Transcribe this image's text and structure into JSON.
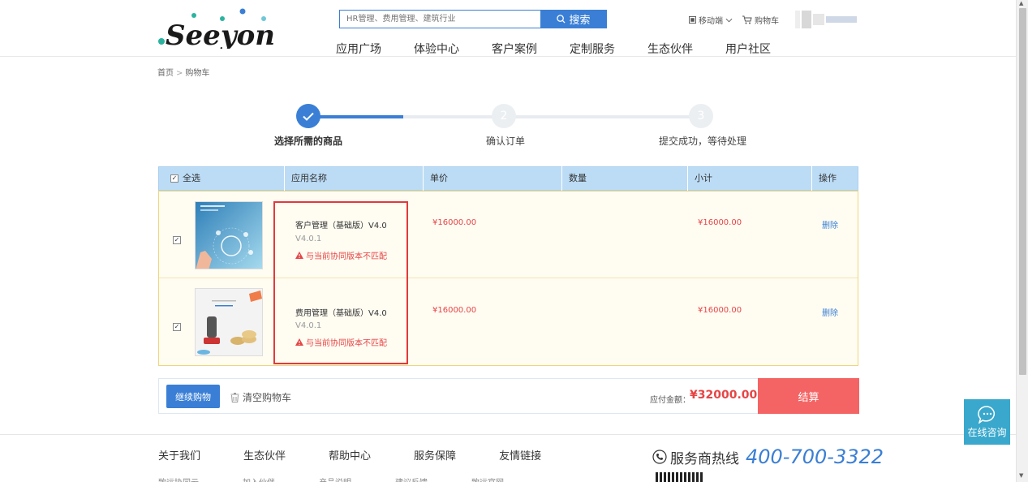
{
  "header": {
    "search_placeholder": "HR管理、费用管理、建筑行业",
    "search_button": "搜索",
    "nav": [
      "应用广场",
      "体验中心",
      "客户案例",
      "定制服务",
      "生态伙伴",
      "用户社区"
    ],
    "mobile_label": "移动端",
    "cart_label": "购物车"
  },
  "breadcrumb": {
    "home": "首页",
    "sep": ">",
    "current": "购物车"
  },
  "steps": [
    {
      "num": "",
      "label": "选择所需的商品",
      "active": true
    },
    {
      "num": "2",
      "label": "确认订单",
      "active": false
    },
    {
      "num": "3",
      "label": "提交成功，等待处理",
      "active": false
    }
  ],
  "table": {
    "headers": {
      "select_all": "全选",
      "name": "应用名称",
      "price": "单价",
      "quantity": "数量",
      "subtotal": "小计",
      "action": "操作"
    },
    "rows": [
      {
        "name": "客户管理（基础版）V4.0",
        "version": "V4.0.1",
        "warning": "与当前协同版本不匹配",
        "price": "¥16000.00",
        "subtotal": "¥16000.00",
        "action": "删除"
      },
      {
        "name": "费用管理（基础版）V4.0",
        "version": "V4.0.1",
        "warning": "与当前协同版本不匹配",
        "price": "¥16000.00",
        "subtotal": "¥16000.00",
        "action": "删除"
      }
    ]
  },
  "action_bar": {
    "continue": "继续购物",
    "clear": "清空购物车",
    "pay_label": "应付金额：",
    "pay_amount": "¥32000.00",
    "checkout": "结算"
  },
  "footer": {
    "links": [
      "关于我们",
      "生态伙伴",
      "帮助中心",
      "服务保障",
      "友情链接"
    ],
    "sub_links": [
      "致远协同云",
      "加入伙伴",
      "产品说明",
      "建议反馈",
      "致远官网"
    ],
    "hotline_label": "服务商热线",
    "hotline_number": "400-700-3322"
  },
  "consult": "在线咨询",
  "colors": {
    "primary": "#3a7fd5",
    "danger": "#e64545",
    "checkout": "#f46464",
    "consult": "#39a8cc"
  }
}
